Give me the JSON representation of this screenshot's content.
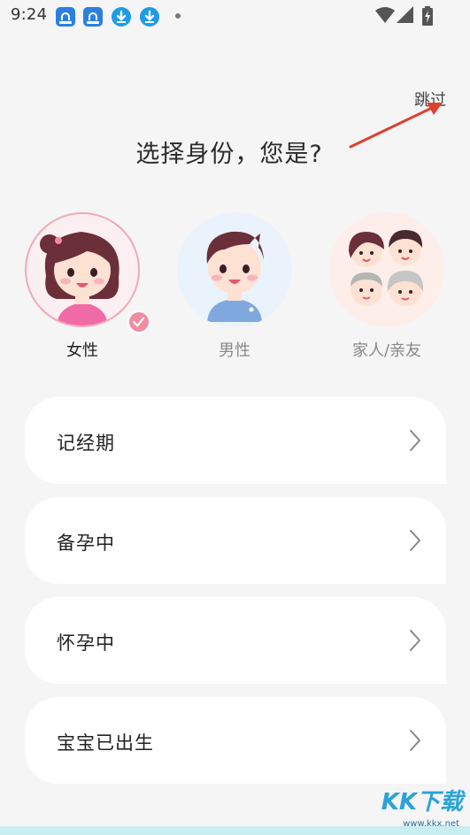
{
  "status_bar": {
    "time": "9:24",
    "notification_icons": [
      "app-notification-icon",
      "app-notification-icon",
      "download-icon",
      "download-icon"
    ],
    "system_icons": [
      "wifi-icon",
      "signal-icon",
      "battery-icon"
    ]
  },
  "header": {
    "skip_label": "跳过",
    "title": "选择身份，您是?"
  },
  "identities": [
    {
      "label": "女性",
      "icon": "female-avatar-icon",
      "selected": true
    },
    {
      "label": "男性",
      "icon": "male-avatar-icon",
      "selected": false
    },
    {
      "label": "家人/亲友",
      "icon": "family-avatar-icon",
      "selected": false
    }
  ],
  "options": [
    {
      "label": "记经期"
    },
    {
      "label": "备孕中"
    },
    {
      "label": "怀孕中"
    },
    {
      "label": "宝宝已出生"
    }
  ],
  "watermark": {
    "brand": "KK下载",
    "url": "www.kkx.net"
  },
  "colors": {
    "background": "#f5f5f6",
    "selected_accent": "#f08da0",
    "arrow": "#e0402e"
  }
}
